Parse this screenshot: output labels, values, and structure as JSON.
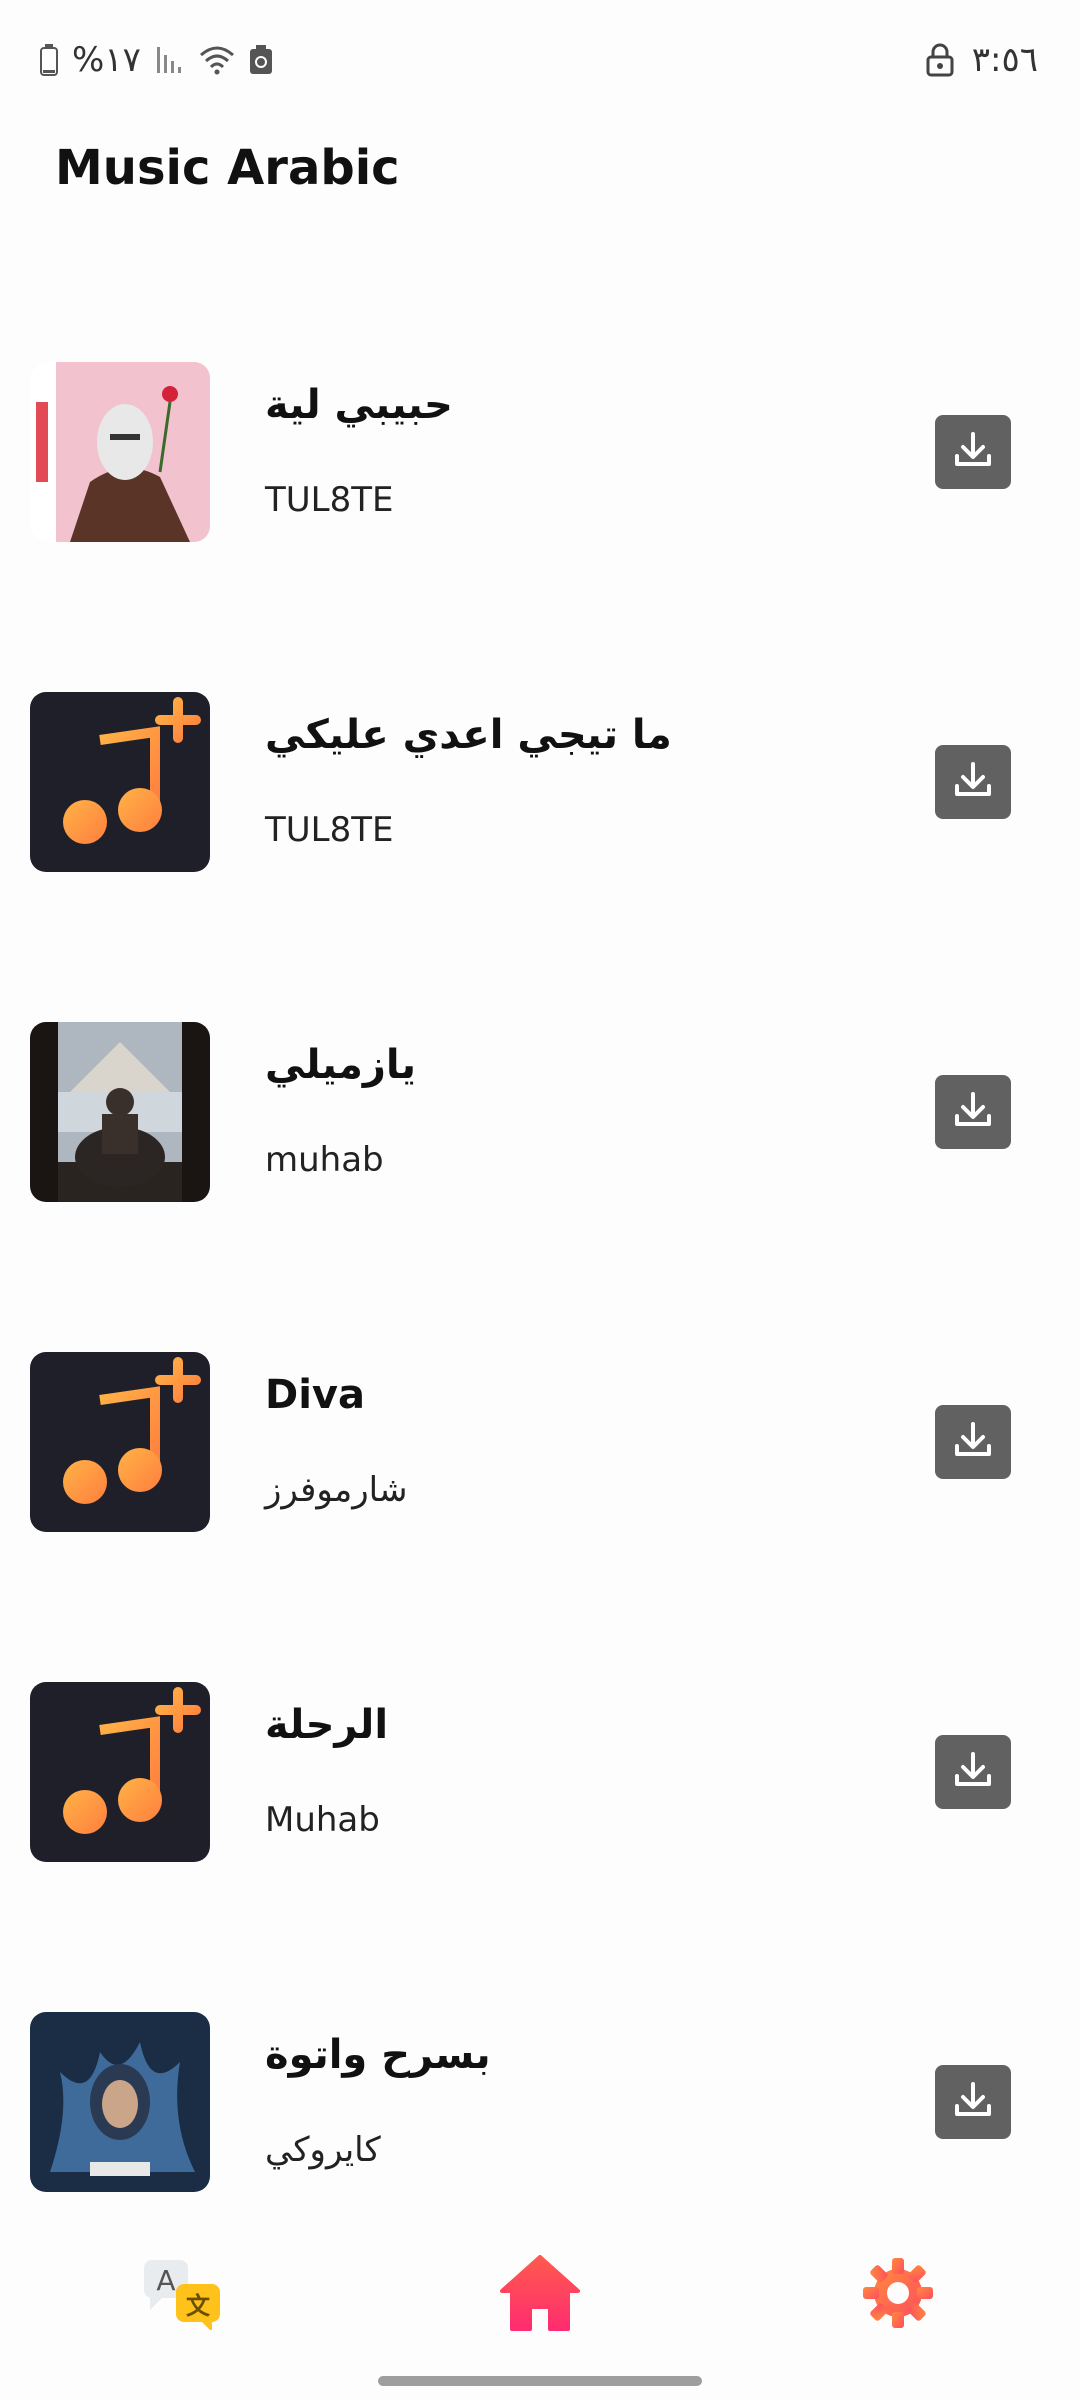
{
  "status_bar": {
    "battery_percent": "%١٧",
    "time": "٣:٥٦"
  },
  "app": {
    "title": "Music Arabic"
  },
  "songs": [
    {
      "title": "حبيبي لية",
      "artist": "TUL8TE",
      "art": "photo-masked-man",
      "action_icon": "download-icon"
    },
    {
      "title": "ما تيجي اعدي عليكي",
      "artist": "TUL8TE",
      "art": "music-note-plus",
      "action_icon": "download-icon"
    },
    {
      "title": "يازميلي",
      "artist": "muhab",
      "art": "photo-pyramids",
      "action_icon": "download-icon"
    },
    {
      "title": "Diva",
      "artist": "شارموفرز",
      "art": "music-note-plus",
      "action_icon": "download-icon"
    },
    {
      "title": "الرحلة",
      "artist": "Muhab",
      "art": "music-note-plus",
      "action_icon": "download-icon"
    },
    {
      "title": "بسرح واتوة",
      "artist": "كايروكي",
      "art": "photo-album-cover",
      "action_icon": "download-icon"
    }
  ],
  "bottom_nav": [
    {
      "name": "translate-icon"
    },
    {
      "name": "home-icon"
    },
    {
      "name": "settings-icon"
    }
  ],
  "colors": {
    "download_button": "#616161",
    "art_dark": "#1f1f2a",
    "note_gradient_start": "#ffb347",
    "note_gradient_end": "#ff7e3e",
    "home_gradient_start": "#ff5a4e",
    "home_gradient_end": "#ff2d6f",
    "settings": "#ff6b4a"
  }
}
